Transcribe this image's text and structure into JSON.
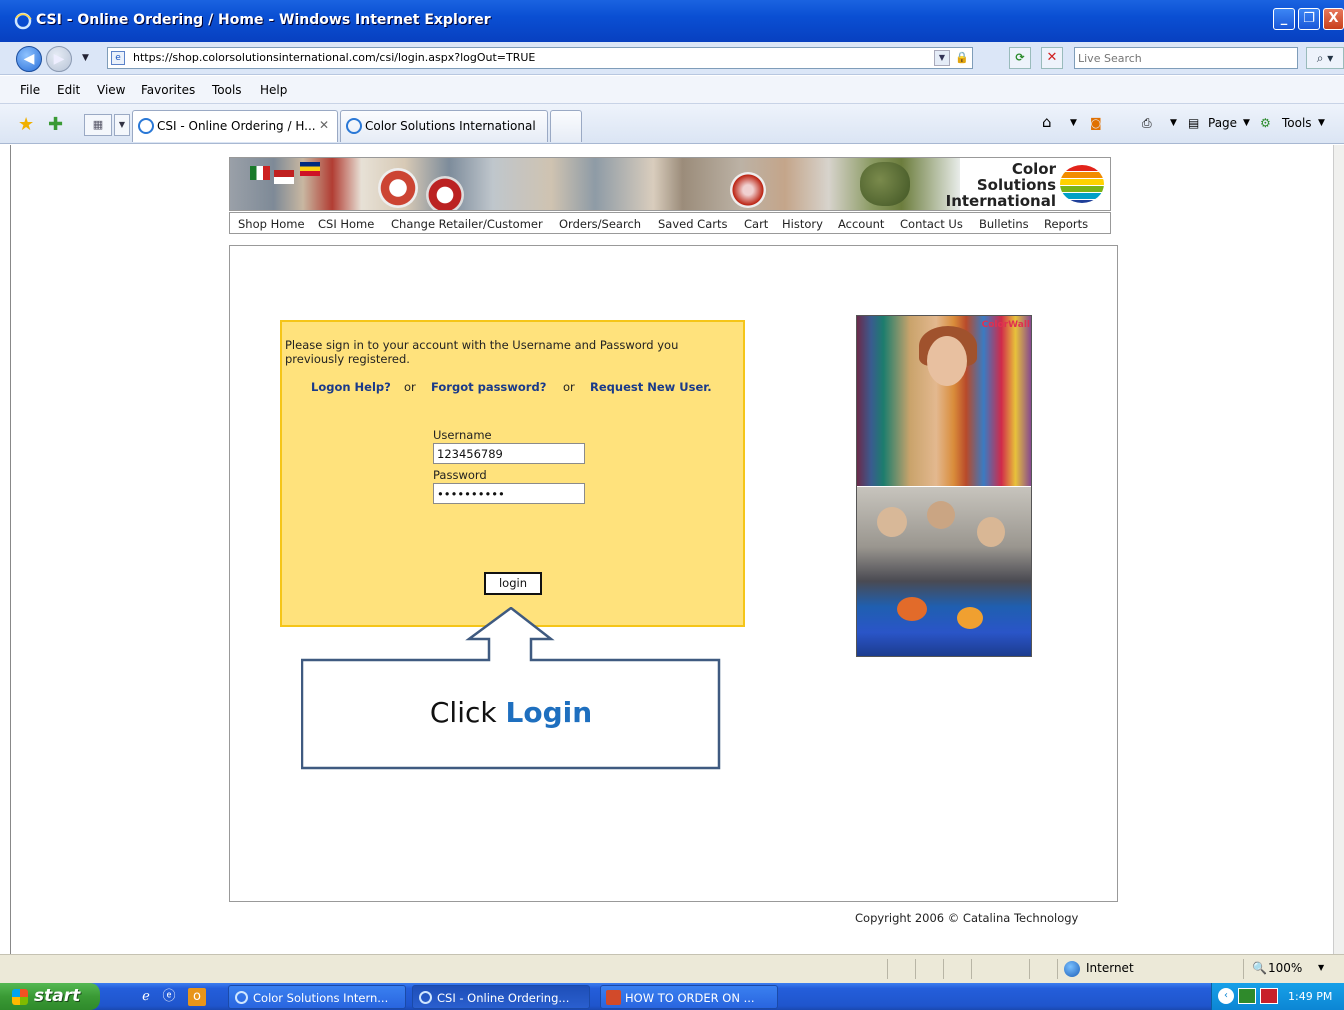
{
  "window": {
    "title": "CSI - Online Ordering / Home - Windows Internet Explorer",
    "min_glyph": "_",
    "max_glyph": "❐",
    "close_glyph": "X"
  },
  "address_bar": {
    "url": "https://shop.colorsolutionsinternational.com/csi/login.aspx?logOut=TRUE",
    "search_placeholder": "Live Search"
  },
  "menu": [
    "File",
    "Edit",
    "View",
    "Favorites",
    "Tools",
    "Help"
  ],
  "tabs": [
    {
      "label": "CSI - Online Ordering / H...",
      "active": true
    },
    {
      "label": "Color Solutions International",
      "active": false
    }
  ],
  "toolbar_right": {
    "page_label": "Page",
    "tools_label": "Tools"
  },
  "site": {
    "logo_lines": [
      "Color",
      "Solutions",
      "International"
    ],
    "logo_colors": [
      "#e2231a",
      "#f28c00",
      "#ffd200",
      "#7ab317",
      "#00a0c6",
      "#1f3f99"
    ],
    "nav": [
      "Shop Home",
      "CSI Home",
      "Change Retailer/Customer",
      "Orders/Search",
      "Saved Carts",
      "Cart",
      "History",
      "Account",
      "Contact Us",
      "Bulletins",
      "Reports"
    ],
    "colorwall_label": "ColorWall"
  },
  "login": {
    "intro": "Please sign in to your account with the Username and Password you previously registered.",
    "logon_help": "Logon Help?",
    "or1": "or",
    "forgot_password": "Forgot password?",
    "or2": "or",
    "request_new_user": "Request New User.",
    "username_label": "Username",
    "username_value": "123456789",
    "password_label": "Password",
    "password_value": "••••••••••",
    "login_button": "login"
  },
  "callout": {
    "text_prefix": "Click ",
    "text_emphasis": "Login"
  },
  "copyright": "Copyright 2006 © Catalina Technology",
  "statusbar": {
    "zone": "Internet",
    "zoom": "100%"
  },
  "taskbar": {
    "start_label": "start",
    "items": [
      {
        "label": "Color Solutions Intern..."
      },
      {
        "label": "CSI - Online Ordering..."
      },
      {
        "label": "HOW TO ORDER ON ..."
      }
    ],
    "clock": "1:49 PM"
  }
}
